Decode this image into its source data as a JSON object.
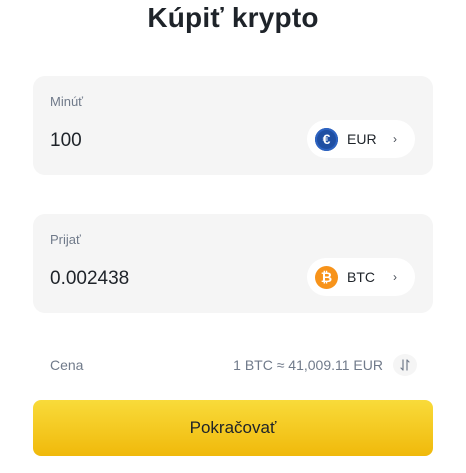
{
  "title": "Kúpiť krypto",
  "pay": {
    "label": "Minúť",
    "amount": "100",
    "currency": {
      "code": "EUR",
      "icon": "euro-icon",
      "symbol": "€",
      "color": "#1f4fa3"
    }
  },
  "receive": {
    "label": "Prijať",
    "amount": "0.002438",
    "currency": {
      "code": "BTC",
      "icon": "bitcoin-icon",
      "symbol": "₿",
      "color": "#f7931a"
    }
  },
  "price": {
    "label": "Cena",
    "value": "1 BTC ≈ 41,009.11 EUR",
    "swap_icon": "swap-icon"
  },
  "cta": {
    "label": "Pokračovať",
    "color": "#f0b90b"
  }
}
